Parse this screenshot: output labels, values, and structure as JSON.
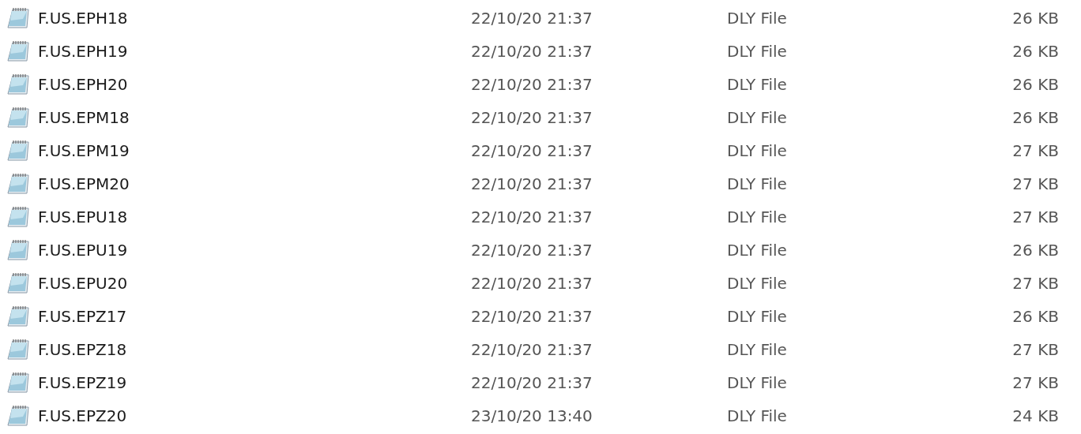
{
  "files": [
    {
      "name": "F.US.EPH18",
      "date": "22/10/20 21:37",
      "type": "DLY File",
      "size": "26 KB"
    },
    {
      "name": "F.US.EPH19",
      "date": "22/10/20 21:37",
      "type": "DLY File",
      "size": "26 KB"
    },
    {
      "name": "F.US.EPH20",
      "date": "22/10/20 21:37",
      "type": "DLY File",
      "size": "26 KB"
    },
    {
      "name": "F.US.EPM18",
      "date": "22/10/20 21:37",
      "type": "DLY File",
      "size": "26 KB"
    },
    {
      "name": "F.US.EPM19",
      "date": "22/10/20 21:37",
      "type": "DLY File",
      "size": "27 KB"
    },
    {
      "name": "F.US.EPM20",
      "date": "22/10/20 21:37",
      "type": "DLY File",
      "size": "27 KB"
    },
    {
      "name": "F.US.EPU18",
      "date": "22/10/20 21:37",
      "type": "DLY File",
      "size": "27 KB"
    },
    {
      "name": "F.US.EPU19",
      "date": "22/10/20 21:37",
      "type": "DLY File",
      "size": "26 KB"
    },
    {
      "name": "F.US.EPU20",
      "date": "22/10/20 21:37",
      "type": "DLY File",
      "size": "27 KB"
    },
    {
      "name": "F.US.EPZ17",
      "date": "22/10/20 21:37",
      "type": "DLY File",
      "size": "26 KB"
    },
    {
      "name": "F.US.EPZ18",
      "date": "22/10/20 21:37",
      "type": "DLY File",
      "size": "27 KB"
    },
    {
      "name": "F.US.EPZ19",
      "date": "22/10/20 21:37",
      "type": "DLY File",
      "size": "27 KB"
    },
    {
      "name": "F.US.EPZ20",
      "date": "23/10/20 13:40",
      "type": "DLY File",
      "size": "24 KB"
    }
  ]
}
